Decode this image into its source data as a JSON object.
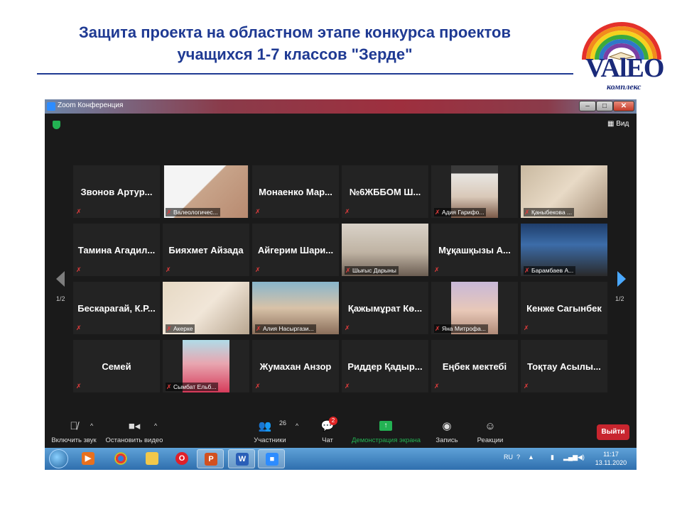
{
  "slide": {
    "title_line1": "Защита проекта на областном этапе конкурса проектов",
    "title_line2": "учащихся 1-7 классов \"Зерде\"",
    "logo_text": "VAlEO",
    "logo_sub": "комплекс"
  },
  "window": {
    "title": "Zoom Конференция",
    "controls": {
      "minimize": "–",
      "maximize": "□",
      "close": "✕"
    },
    "view_label": "Вид",
    "page_left": "1/2",
    "page_right": "1/2"
  },
  "tiles": [
    {
      "name": "Звонов Артур...",
      "label": "",
      "video": false
    },
    {
      "name": "",
      "label": "Валеологичес...",
      "video": true
    },
    {
      "name": "Монаенко Мар...",
      "label": "",
      "video": false
    },
    {
      "name": "№6ЖББОМ Ш...",
      "label": "",
      "video": false
    },
    {
      "name": "",
      "label": "Адия Гарифо...",
      "video": true
    },
    {
      "name": "",
      "label": "Қаныбекова ...",
      "video": true
    },
    {
      "name": "Тамина Агадил...",
      "label": "",
      "video": false
    },
    {
      "name": "Бияхмет Айзада",
      "label": "",
      "video": false
    },
    {
      "name": "Айгерим Шари...",
      "label": "",
      "video": false
    },
    {
      "name": "",
      "label": "Шығыс Дарыны",
      "video": true
    },
    {
      "name": "Мұқашқызы А...",
      "label": "",
      "video": false
    },
    {
      "name": "",
      "label": "Барамбаев А...",
      "video": true
    },
    {
      "name": "Бескарагай, К.Р...",
      "label": "",
      "video": false
    },
    {
      "name": "",
      "label": "Акерке",
      "video": true
    },
    {
      "name": "",
      "label": "Алия Насыргази...",
      "video": true
    },
    {
      "name": "Қажымұрат Кө...",
      "label": "",
      "video": false
    },
    {
      "name": "",
      "label": "Яна Митрофа...",
      "video": true
    },
    {
      "name": "Кенже Сагынбек",
      "label": "",
      "video": false
    },
    {
      "name": "Семей",
      "label": "",
      "video": false
    },
    {
      "name": "",
      "label": "Сымбат Ельб...",
      "video": true
    },
    {
      "name": "Жумахан Анзор",
      "label": "",
      "video": false
    },
    {
      "name": "Риддер Қадыр...",
      "label": "",
      "video": false
    },
    {
      "name": "Еңбек мектебі",
      "label": "",
      "video": false
    },
    {
      "name": "Тоқтау Асылы...",
      "label": "",
      "video": false
    }
  ],
  "toolbar": {
    "unmute_label": "Включить звук",
    "stop_video_label": "Остановить видео",
    "participants_label": "Участники",
    "participants_count": "26",
    "chat_label": "Чат",
    "chat_badge": "2",
    "share_label": "Демонстрация экрана",
    "record_label": "Запись",
    "reactions_label": "Реакции",
    "end_label": "Выйти"
  },
  "taskbar": {
    "lang": "RU",
    "time": "11:17",
    "date": "13.11.2020"
  },
  "colors": {
    "title_blue": "#1f3a93",
    "zoom_bg": "#1a1a1a",
    "share_green": "#23b253",
    "end_red": "#c8252e",
    "mute_red": "#e03c3c",
    "active_outline": "#c7d84a"
  }
}
